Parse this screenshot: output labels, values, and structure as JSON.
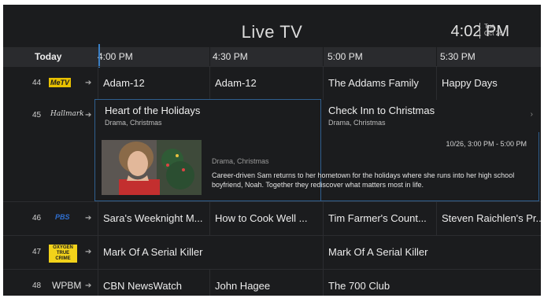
{
  "header": {
    "title": "Live TV",
    "time": "4:02 PM",
    "day": "Tue",
    "date": "Oct 26"
  },
  "timebar": {
    "today_label": "Today",
    "slots": [
      "4:00 PM",
      "4:30 PM",
      "5:00 PM",
      "5:30 PM"
    ]
  },
  "channels": [
    {
      "number": "44",
      "logo": "MeTV",
      "programs": [
        "Adam-12",
        "Adam-12",
        "The Addams Family",
        "Happy Days"
      ]
    },
    {
      "number": "45",
      "logo": "Hallmark",
      "programs": [
        "Heart of the Holidays",
        "Check Inn to Christmas"
      ]
    },
    {
      "number": "46",
      "logo": "PBS",
      "programs": [
        "Sara's Weeknight M...",
        "How to Cook Well ...",
        "Tim Farmer's Count...",
        "Steven Raichlen's Pr..."
      ]
    },
    {
      "number": "47",
      "logo": "OXYGEN TRUE CRIME",
      "programs": [
        "Mark Of A Serial Killer",
        "Mark Of A Serial Killer"
      ]
    },
    {
      "number": "48",
      "logo": "WPBM",
      "programs": [
        "CBN NewsWatch",
        "John Hagee",
        "The 700 Club"
      ]
    }
  ],
  "focused": {
    "title": "Heart of the Holidays",
    "genre": "Drama, Christmas",
    "next_title": "Check Inn to Christmas",
    "next_genre": "Drama, Christmas",
    "detail_genre": "Drama, Christmas",
    "time_span": "10/26, 3:00 PM - 5:00 PM",
    "description": "Career-driven Sam returns to her hometown for the holidays where she runs into her high school boyfriend, Noah. Together they rediscover what matters most in life.",
    "more_icon": "chevron-right-icon"
  },
  "colors": {
    "background": "#1b1c1e",
    "header_bar": "#2a2b2e",
    "focus_border": "#2f5f8f",
    "now_line": "#3b7fc4",
    "metv_yellow": "#e8c000",
    "oxygen_yellow": "#f2d21a"
  }
}
